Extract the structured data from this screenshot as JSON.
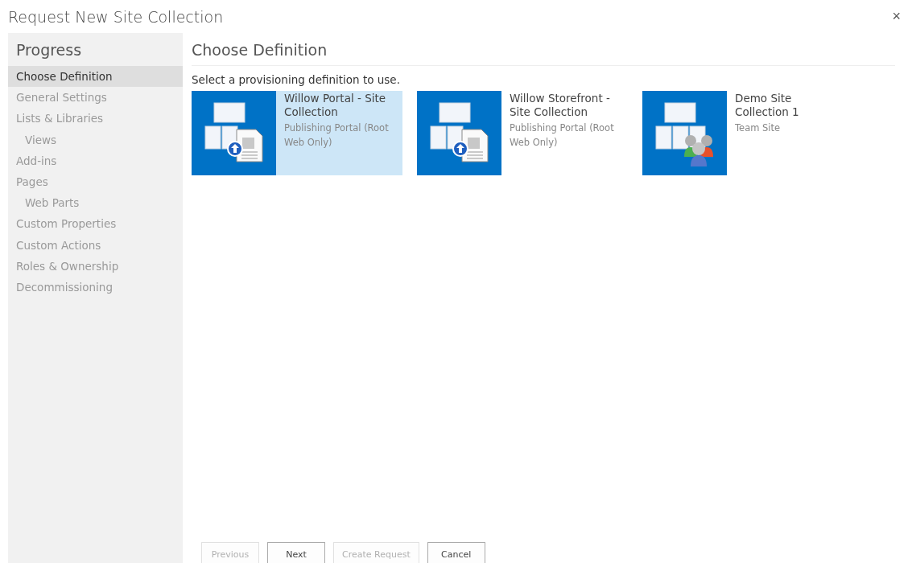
{
  "dialog": {
    "title": "Request New Site Collection",
    "close": "×"
  },
  "progress": {
    "heading": "Progress",
    "steps": [
      {
        "label": "Choose Definition",
        "selected": true
      },
      {
        "label": "General Settings",
        "selected": false
      },
      {
        "label": "Lists & Libraries",
        "selected": false,
        "children": [
          {
            "label": "Views",
            "selected": false
          }
        ]
      },
      {
        "label": "Add-ins",
        "selected": false
      },
      {
        "label": "Pages",
        "selected": false,
        "children": [
          {
            "label": "Web Parts",
            "selected": false
          }
        ]
      },
      {
        "label": "Custom Properties",
        "selected": false
      },
      {
        "label": "Custom Actions",
        "selected": false
      },
      {
        "label": "Roles & Ownership",
        "selected": false
      },
      {
        "label": "Decommissioning",
        "selected": false
      }
    ]
  },
  "content": {
    "heading": "Choose Definition",
    "instruction": "Select a provisioning definition to use.",
    "definitions": [
      {
        "title": "Willow Portal - Site Collection",
        "subtitle": "Publishing Portal (Root Web Only)",
        "kind": "publishing",
        "selected": true
      },
      {
        "title": "Willow Storefront - Site Collection",
        "subtitle": "Publishing Portal (Root Web Only)",
        "kind": "publishing",
        "selected": false
      },
      {
        "title": "Demo Site Collection 1",
        "subtitle": "Team Site",
        "kind": "team",
        "selected": false
      }
    ]
  },
  "buttons": [
    {
      "label": "Previous",
      "disabled": true
    },
    {
      "label": "Next",
      "disabled": false
    },
    {
      "label": "Create Request",
      "disabled": true
    },
    {
      "label": "Cancel",
      "disabled": false
    }
  ]
}
